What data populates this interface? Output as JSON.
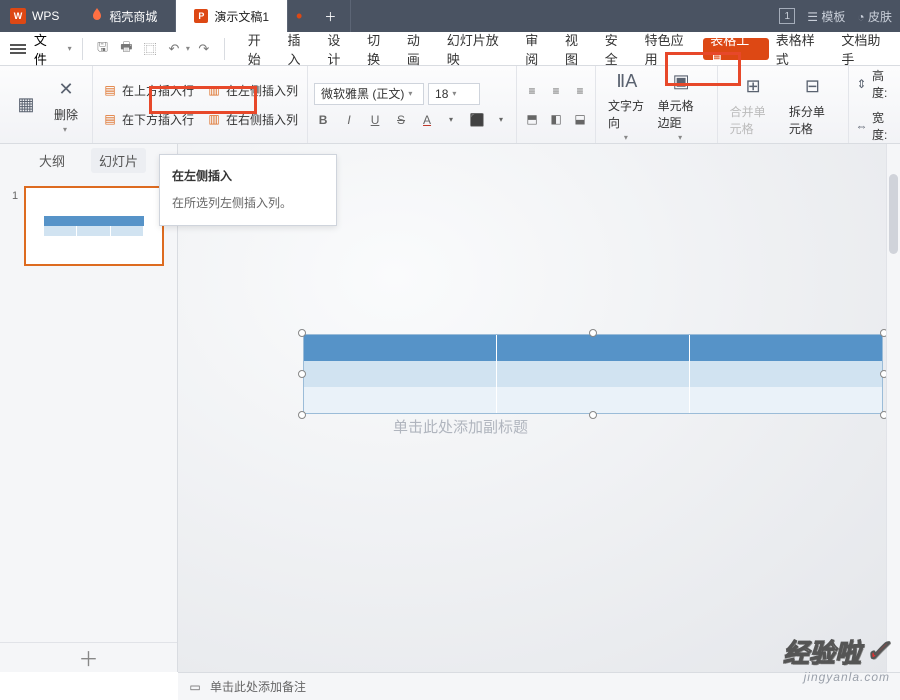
{
  "title_bar": {
    "wps_label": "WPS",
    "tab_store": "稻壳商城",
    "tab_doc": "演示文稿1",
    "page_num": "1",
    "template_label": "模板",
    "skin_label": "皮肤"
  },
  "menubar": {
    "file_label": "文件",
    "items": [
      "开始",
      "插入",
      "设计",
      "切换",
      "动画",
      "幻灯片放映",
      "审阅",
      "视图",
      "安全",
      "特色应用",
      "表格工具",
      "表格样式",
      "文档助手"
    ]
  },
  "ribbon": {
    "delete_label": "删除",
    "insert_row_above": "在上方插入行",
    "insert_row_below": "在下方插入行",
    "insert_col_left": "在左侧插入列",
    "insert_col_right": "在右侧插入列",
    "font_name": "微软雅黑 (正文)",
    "font_size": "18",
    "text_direction": "文字方向",
    "cell_margins": "单元格边距",
    "merge_cells": "合并单元格",
    "split_cells": "拆分单元格",
    "height_label": "高度:",
    "width_label": "宽度:"
  },
  "outline": {
    "tab_outline": "大纲",
    "tab_slides": "幻灯片",
    "slide_num": "1"
  },
  "tooltip": {
    "title": "在左侧插入",
    "body": "在所选列左侧插入列。"
  },
  "canvas": {
    "ghost_text": "单击此处添加副标题"
  },
  "statusbar": {
    "notes_placeholder": "单击此处添加备注"
  },
  "watermark": {
    "line1": "经验啦",
    "line2": "jingyanla.com"
  }
}
